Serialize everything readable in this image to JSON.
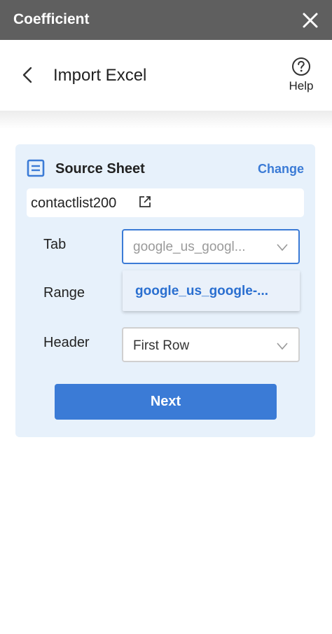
{
  "app": {
    "title": "Coefficient"
  },
  "header": {
    "title": "Import Excel",
    "help_label": "Help"
  },
  "source_card": {
    "title": "Source Sheet",
    "change_label": "Change",
    "file_name": "contactlist200"
  },
  "form": {
    "tab": {
      "label": "Tab",
      "selected_value": "google_us_googl...",
      "dropdown_option": "google_us_google-..."
    },
    "range": {
      "label": "Range"
    },
    "header": {
      "label": "Header",
      "selected_value": "First Row"
    }
  },
  "actions": {
    "next_label": "Next"
  },
  "icons": {
    "close": "close-icon",
    "back": "chevron-left-icon",
    "help": "help-circle-icon",
    "sheet": "sheet-icon",
    "external": "external-link-icon",
    "dropdown": "chevron-down-icon"
  },
  "colors": {
    "titlebar": "#5f5f5f",
    "accent": "#3b7bd6",
    "card_bg": "#e7f1fb"
  }
}
